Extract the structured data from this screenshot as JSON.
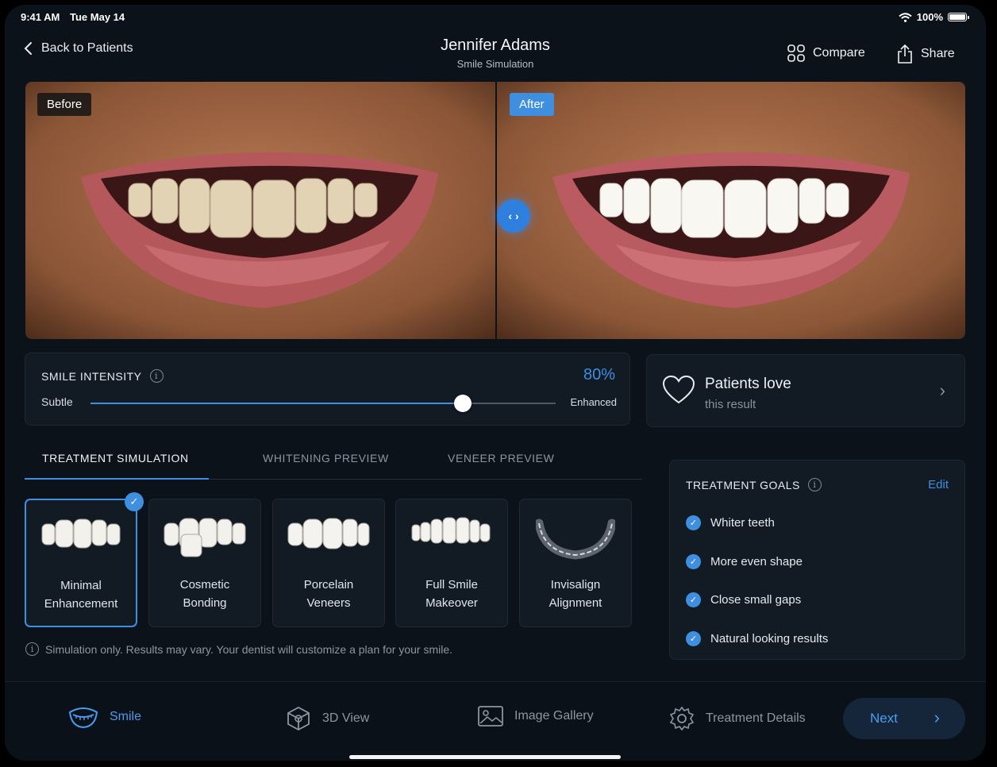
{
  "status": {
    "time": "9:41 AM",
    "date": "Tue May 14",
    "battery": "100%"
  },
  "header": {
    "back_label": "Back to Patients",
    "patient_name": "Jennifer Adams",
    "subtitle": "Smile Simulation",
    "compare_label": "Compare",
    "share_label": "Share"
  },
  "compare": {
    "before_label": "Before",
    "after_label": "After"
  },
  "intensity": {
    "label": "SMILE INTENSITY",
    "value_text": "80%",
    "value": 0.8,
    "min_label": "Subtle",
    "max_label": "Enhanced"
  },
  "love_card": {
    "title": "Patients love",
    "subtitle": "this result"
  },
  "tabs": [
    {
      "label": "TREATMENT SIMULATION",
      "active": true
    },
    {
      "label": "WHITENING PREVIEW",
      "active": false
    },
    {
      "label": "VENEER PREVIEW",
      "active": false
    }
  ],
  "treatments": [
    {
      "line1": "Minimal",
      "line2": "Enhancement",
      "icon": "teeth-minimal-icon",
      "selected": true
    },
    {
      "line1": "Cosmetic",
      "line2": "Bonding",
      "icon": "teeth-bonding-icon",
      "selected": false
    },
    {
      "line1": "Porcelain",
      "line2": "Veneers",
      "icon": "teeth-veneers-icon",
      "selected": false
    },
    {
      "line1": "Full Smile",
      "line2": "Makeover",
      "icon": "teeth-makeover-icon",
      "selected": false
    },
    {
      "line1": "Invisalign",
      "line2": "Alignment",
      "icon": "aligner-icon",
      "selected": false
    }
  ],
  "disclaimer": "Simulation only. Results may vary. Your dentist will customize a plan for your smile.",
  "goals": {
    "label": "TREATMENT GOALS",
    "edit_label": "Edit",
    "items": [
      "Whiter teeth",
      "More even shape",
      "Close small gaps",
      "Natural looking results"
    ]
  },
  "bottom_nav": {
    "items": [
      {
        "label": "Smile",
        "icon": "smile-icon",
        "active": true
      },
      {
        "label": "3D View",
        "icon": "cube-icon",
        "active": false
      },
      {
        "label": "Image Gallery",
        "icon": "image-icon",
        "active": false
      },
      {
        "label": "Treatment Details",
        "icon": "gear-icon",
        "active": false
      }
    ],
    "next_label": "Next"
  },
  "colors": {
    "accent": "#3f8fe0",
    "background": "#0c1219",
    "card": "#121a23"
  }
}
